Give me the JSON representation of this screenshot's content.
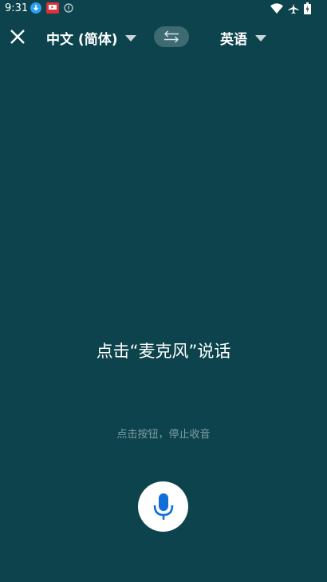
{
  "status_bar": {
    "time": "9:31",
    "left_icons": [
      "download-icon",
      "notification-app-icon",
      "alert-icon"
    ],
    "right_icons": [
      "wifi-icon",
      "airplane-icon",
      "battery-icon"
    ]
  },
  "toolbar": {
    "source_language": "中文 (简体)",
    "target_language": "英语",
    "close_icon": "close-icon",
    "swap_icon": "swap-icon"
  },
  "main": {
    "prompt": "点击“麦克风”说话",
    "hint": "点击按钮，停止收音"
  },
  "colors": {
    "background": "#0c434c",
    "swap_bg": "#3e6a71",
    "mic_icon": "#0f6fd7",
    "hint_text": "#7f9ea3"
  }
}
